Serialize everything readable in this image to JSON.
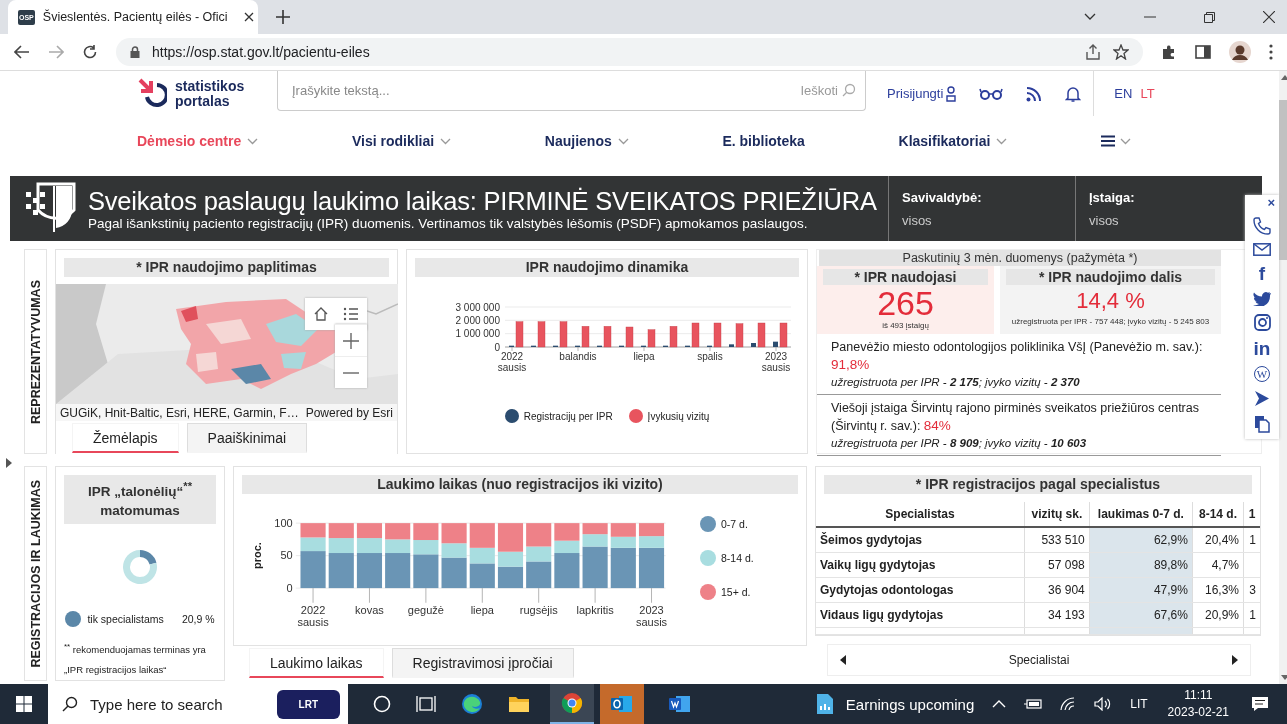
{
  "browser": {
    "favicon": "OSP",
    "tab_title": "Švieslentės. Pacientų eilės - Ofici",
    "url": "https://osp.stat.gov.lt/pacientu-eiles"
  },
  "header": {
    "logo_lines": [
      "statistikos",
      "portalas"
    ],
    "search": {
      "placeholder": "Įrašykite tekstą...",
      "button": "Ieškoti"
    },
    "login": "Prisijungti",
    "languages": [
      {
        "label": "EN",
        "selected": false
      },
      {
        "label": "LT",
        "selected": true
      }
    ]
  },
  "nav": [
    {
      "label": "Dėmesio centre",
      "selected": true,
      "dropdown": true
    },
    {
      "label": "Visi rodikliai",
      "selected": false,
      "dropdown": true
    },
    {
      "label": "Naujienos",
      "selected": false,
      "dropdown": true
    },
    {
      "label": "E. biblioteka",
      "selected": false,
      "dropdown": false
    },
    {
      "label": "Klasifikatoriai",
      "selected": false,
      "dropdown": true
    }
  ],
  "banner": {
    "title": "Sveikatos paslaugų laukimo laikas: PIRMINĖ SVEIKATOS PRIEŽIŪRA",
    "subtitle": "Pagal išankstinių paciento registracijų (IPR) duomenis. Vertinamos tik valstybės lėšomis (PSDF) apmokamos paslaugos.",
    "filters": [
      {
        "label": "Savivaldybė:",
        "value": "visos"
      },
      {
        "label": "Įstaiga:",
        "value": "visos"
      }
    ]
  },
  "share": {
    "close": "×",
    "items": [
      {
        "kind": "phone"
      },
      {
        "kind": "mail"
      },
      {
        "kind": "glyph",
        "text": "f"
      },
      {
        "kind": "bird"
      },
      {
        "kind": "camera"
      },
      {
        "kind": "glyph",
        "text": "in"
      },
      {
        "kind": "circle-glyph",
        "text": "W"
      },
      {
        "kind": "play"
      },
      {
        "kind": "document"
      }
    ]
  },
  "section_labels": [
    "REPREZENTATYVUMAS",
    "REGISTRACIJOS IR LAUKIMAS"
  ],
  "map_panel": {
    "title": "* IPR naudojimo paplitimas",
    "attribution": "GUGiK, Hnit-Baltic, Esri, HERE, Garmin, F…",
    "powered_by": "Powered by Esri",
    "tabs": [
      {
        "label": "Žemėlapis",
        "selected": true
      },
      {
        "label": "Paaiškinimai",
        "selected": false
      }
    ]
  },
  "dynamics_panel": {
    "title": "IPR naudojimo dinamika",
    "chart_data": {
      "type": "bar",
      "categories": [
        "2022 sausis",
        null,
        null,
        "balandis",
        null,
        null,
        "liepa",
        null,
        null,
        "spalis",
        null,
        null,
        "2023 sausis"
      ],
      "yticks": [
        {
          "value": 0,
          "label": "0"
        },
        {
          "value": 1000000,
          "label": "1 000 000"
        },
        {
          "value": 2000000,
          "label": "2 000 000"
        },
        {
          "value": 3000000,
          "label": "3 000 000"
        }
      ],
      "ylim": [
        0,
        3000000
      ],
      "series": [
        {
          "name": "Registracijų per IPR",
          "color": "#2b4c6f",
          "values": [
            100000,
            100000,
            100000,
            100000,
            100000,
            100000,
            100000,
            100000,
            100000,
            100000,
            200000,
            300000,
            400000
          ]
        },
        {
          "name": "Įvykusių vizitų",
          "color": "#e8545e",
          "values": [
            1900000,
            1900000,
            1900000,
            1550000,
            1550000,
            1500000,
            1300000,
            1550000,
            1800000,
            1800000,
            1750000,
            1800000,
            1800000
          ]
        }
      ]
    }
  },
  "recent_panel": {
    "title": "Paskutinių 3 mėn. duomenys (pažymėta *)",
    "stats": [
      {
        "title": "* IPR naudojasi",
        "value": "265",
        "note": "iš 493 įstaigų"
      },
      {
        "title": "* IPR naudojimo dalis",
        "value": "14,4 %",
        "note": "užregistruota per IPR - 757 448; įvyko vizitų - 5 245 803"
      }
    ],
    "institutions": [
      {
        "name": "Panevėžio miesto odontologijos poliklinika VšĮ (Panevėžio m. sav.):",
        "percent": "91,8%",
        "detail": "užregistruota per IPR - **2 175**;  įvyko vizitų - **2 370**"
      },
      {
        "name": "Viešoji įstaiga Širvintų rajono pirminės sveikatos priežiūros centras (Širvintų r. sav.):",
        "percent": "84%",
        "detail": "užregistruota per IPR - **8 909**;  įvyko vizitų - **10 603**"
      }
    ]
  },
  "visibility_panel": {
    "title": "IPR „talonėlių“$^{**}$ matomumas",
    "chart_data": {
      "type": "donut",
      "categories": [
        "tik specialistams",
        null
      ],
      "values": [
        20.9,
        79.1
      ],
      "colors": [
        "#5b87a8",
        "#bfe4e6"
      ],
      "value_labels": [
        "20,9 %",
        null
      ]
    },
    "footnote": "$^{**}$ rekomenduojamas terminas yra „IPR registracijos laikas“"
  },
  "waiting_panel": {
    "title": "Laukimo laikas (nuo registracijos iki vizito)",
    "chart_data": {
      "type": "bar",
      "stacked": true,
      "ylabel": "proc.",
      "categories": [
        "2022 sausis",
        null,
        "kovas",
        null,
        "gegužė",
        null,
        "liepa",
        null,
        "rugsėjis",
        null,
        "lapkritis",
        null,
        "2023 sausis"
      ],
      "yticks": [
        0,
        50,
        100
      ],
      "ylim": [
        0,
        100
      ],
      "series": [
        {
          "name": "0-7 d.",
          "color": "#6a95b5",
          "values": [
            57,
            54,
            54,
            54,
            52,
            47,
            38,
            33,
            41,
            54,
            64,
            62,
            62
          ]
        },
        {
          "name": "8-14 d.",
          "color": "#a8dde0",
          "values": [
            21,
            23,
            23,
            21,
            22,
            22,
            24,
            23,
            23,
            19,
            19,
            17,
            18
          ]
        },
        {
          "name": "15+ d.",
          "color": "#ee8188",
          "values": [
            22,
            23,
            23,
            25,
            26,
            31,
            38,
            44,
            36,
            27,
            17,
            21,
            20
          ]
        }
      ]
    },
    "tabs": [
      {
        "label": "Laukimo laikas",
        "selected": true
      },
      {
        "label": "Registravimosi įpročiai",
        "selected": false
      }
    ]
  },
  "specialists_panel": {
    "title": "* IPR registracijos pagal specialistus",
    "columns": [
      "Specialistas",
      "vizitų sk.",
      "laukimas 0-7 d.",
      "8-14 d.",
      "1"
    ],
    "rows": [
      [
        "Šeimos gydytojas",
        "533 510",
        "62,9%",
        "20,4%",
        "1"
      ],
      [
        "Vaikų ligų gydytojas",
        "57 098",
        "89,8%",
        "4,7%",
        null
      ],
      [
        "Gydytojas odontologas",
        "36 904",
        "47,9%",
        "16,3%",
        "3"
      ],
      [
        "Vidaus ligų gydytojas",
        "34 193",
        "67,6%",
        "20,9%",
        "1"
      ]
    ],
    "pager": "Specialistai"
  },
  "taskbar": {
    "search_placeholder": "Type here to search",
    "app_label": "LRT",
    "news": "Earnings upcoming",
    "language": "LIT",
    "time": "11:11",
    "date": "2023-02-21"
  }
}
